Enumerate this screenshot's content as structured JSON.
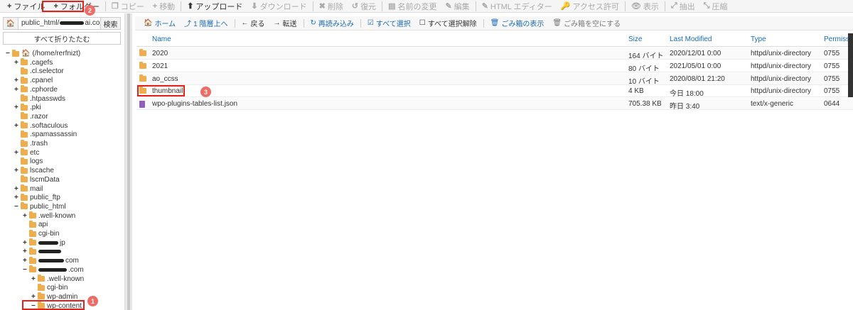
{
  "toolbar": {
    "items": [
      {
        "icon": "+",
        "label": "ファイル",
        "disabled": false
      },
      {
        "icon": "+",
        "label": "フォルダー",
        "disabled": false
      },
      {
        "icon": "❐",
        "label": "コピー",
        "disabled": true
      },
      {
        "icon": "+",
        "label": "移動",
        "disabled": true
      },
      {
        "icon": "⬆",
        "label": "アップロード",
        "disabled": false
      },
      {
        "icon": "⬇",
        "label": "ダウンロード",
        "disabled": true
      },
      {
        "icon": "✖",
        "label": "削除",
        "disabled": true
      },
      {
        "icon": "↺",
        "label": "復元",
        "disabled": true
      },
      {
        "icon": "▤",
        "label": "名前の変更",
        "disabled": true
      },
      {
        "icon": "✎",
        "label": "編集",
        "disabled": true
      },
      {
        "icon": "✎",
        "label": "HTML エディター",
        "disabled": true
      },
      {
        "icon": "🔑",
        "label": "アクセス許可",
        "disabled": true
      },
      {
        "icon": "👁",
        "label": "表示",
        "disabled": true
      },
      {
        "icon": "⤢",
        "label": "抽出",
        "disabled": true
      },
      {
        "icon": "⤡",
        "label": "圧縮",
        "disabled": true
      }
    ]
  },
  "left": {
    "path_value": "public_html/",
    "path_suffix": "ai.co",
    "search_label": "検索",
    "collapse_label": "すべて折りたたむ",
    "tree": [
      {
        "exp": "−",
        "label": "(/home/rerfnizt)",
        "indent": 0,
        "icon": "house"
      },
      {
        "exp": "+",
        "label": ".cagefs",
        "indent": 1
      },
      {
        "exp": "",
        "label": ".cl.selector",
        "indent": 1
      },
      {
        "exp": "+",
        "label": ".cpanel",
        "indent": 1
      },
      {
        "exp": "+",
        "label": ".cphorde",
        "indent": 1
      },
      {
        "exp": "",
        "label": ".htpasswds",
        "indent": 1
      },
      {
        "exp": "+",
        "label": ".pki",
        "indent": 1
      },
      {
        "exp": "",
        "label": ".razor",
        "indent": 1
      },
      {
        "exp": "+",
        "label": ".softaculous",
        "indent": 1
      },
      {
        "exp": "",
        "label": ".spamassassin",
        "indent": 1
      },
      {
        "exp": "",
        "label": ".trash",
        "indent": 1
      },
      {
        "exp": "+",
        "label": "etc",
        "indent": 1
      },
      {
        "exp": "",
        "label": "logs",
        "indent": 1
      },
      {
        "exp": "+",
        "label": "lscache",
        "indent": 1
      },
      {
        "exp": "",
        "label": "lscmData",
        "indent": 1
      },
      {
        "exp": "+",
        "label": "mail",
        "indent": 1
      },
      {
        "exp": "+",
        "label": "public_ftp",
        "indent": 1
      },
      {
        "exp": "−",
        "label": "public_html",
        "indent": 1
      },
      {
        "exp": "+",
        "label": ".well-known",
        "indent": 2
      },
      {
        "exp": "",
        "label": "api",
        "indent": 2
      },
      {
        "exp": "",
        "label": "cgi-bin",
        "indent": 2
      },
      {
        "exp": "+",
        "label": "jp",
        "indent": 2
      },
      {
        "exp": "+",
        "label": "",
        "indent": 2
      },
      {
        "exp": "+",
        "label": "com",
        "indent": 2
      },
      {
        "exp": "−",
        "label": ".com",
        "indent": 2
      },
      {
        "exp": "+",
        "label": ".well-known",
        "indent": 3
      },
      {
        "exp": "",
        "label": "cgi-bin",
        "indent": 3
      },
      {
        "exp": "+",
        "label": "wp-admin",
        "indent": 3
      },
      {
        "exp": "−",
        "label": "wp-content",
        "indent": 3
      }
    ]
  },
  "nav": {
    "items": [
      {
        "icon": "🏠",
        "label": "ホーム",
        "style": ""
      },
      {
        "icon": "⤴",
        "label": "1 階層上へ",
        "style": ""
      },
      {
        "icon": "←",
        "label": "戻る",
        "style": "dark"
      },
      {
        "icon": "→",
        "label": "転送",
        "style": "dark"
      },
      {
        "icon": "↻",
        "label": "再読み込み",
        "style": ""
      },
      {
        "icon": "☑",
        "label": "すべて選択",
        "style": ""
      },
      {
        "icon": "☐",
        "label": "すべて選択解除",
        "style": "dark"
      },
      {
        "icon": "🗑",
        "label": "ごみ箱の表示",
        "style": ""
      },
      {
        "icon": "🗑",
        "label": "ごみ箱を空にする",
        "style": "muted"
      }
    ]
  },
  "table": {
    "headers": {
      "name": "Name",
      "size": "Size",
      "modified": "Last Modified",
      "type": "Type",
      "perm": "Permission"
    },
    "rows": [
      {
        "kind": "folder",
        "name": "2020",
        "size": "164 バイト",
        "modified": "2020/12/01 0:00",
        "type": "httpd/unix-directory",
        "perm": "0755"
      },
      {
        "kind": "folder",
        "name": "2021",
        "size": "80 バイト",
        "modified": "2021/05/01 0:00",
        "type": "httpd/unix-directory",
        "perm": "0755"
      },
      {
        "kind": "folder",
        "name": "ao_ccss",
        "size": "10 バイト",
        "modified": "2020/08/01 21:20",
        "type": "httpd/unix-directory",
        "perm": "0755"
      },
      {
        "kind": "folder",
        "name": "thumbnail",
        "size": "4 KB",
        "modified": "今日 18:00",
        "type": "httpd/unix-directory",
        "perm": "0755"
      },
      {
        "kind": "file",
        "name": "wpo-plugins-tables-list.json",
        "size": "705.38 KB",
        "modified": "昨日 3:40",
        "type": "text/x-generic",
        "perm": "0644"
      }
    ]
  },
  "annotations": {
    "badge1": "1",
    "badge2": "2",
    "badge3": "3"
  },
  "colors": {
    "accent": "#1a6ab5",
    "folder": "#f0ad4e",
    "annotation": "#e8201a",
    "badge": "#ef6b66"
  }
}
